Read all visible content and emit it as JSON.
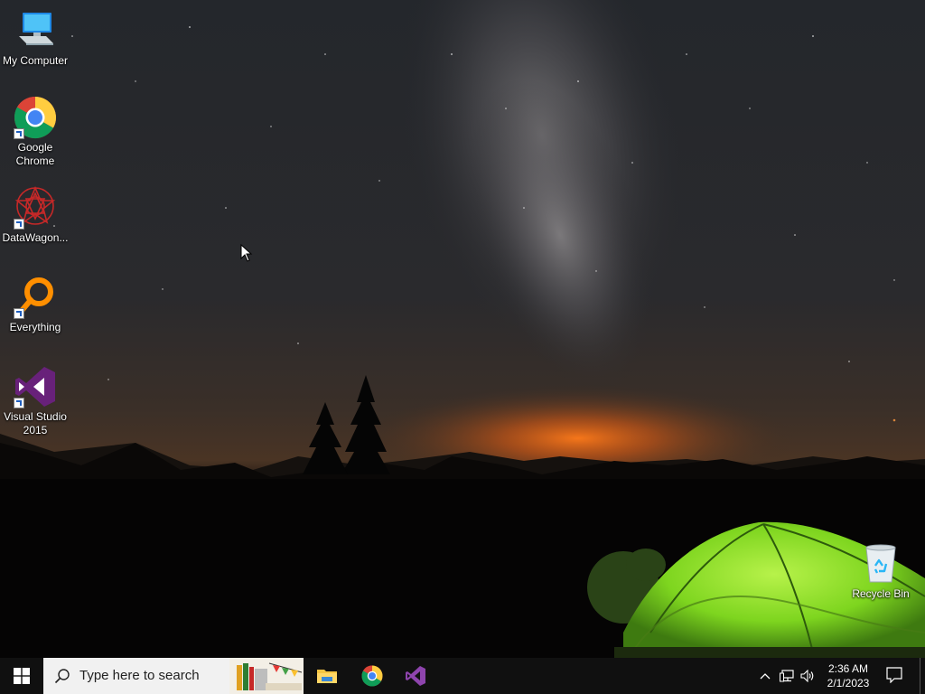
{
  "desktop": {
    "icons": [
      {
        "label": "My Computer",
        "icon": "computer-icon"
      },
      {
        "label": "Google Chrome",
        "icon": "chrome-icon"
      },
      {
        "label": "DataWagon...",
        "icon": "datawagon-icon"
      },
      {
        "label": "Everything",
        "icon": "everything-search-icon"
      },
      {
        "label": "Visual Studio 2015",
        "icon": "visual-studio-icon"
      },
      {
        "label": "Recycle Bin",
        "icon": "recycle-bin-icon"
      }
    ]
  },
  "taskbar": {
    "search_placeholder": "Type here to search",
    "pinned_apps": [
      "File Explorer",
      "Google Chrome",
      "Visual Studio 2015"
    ],
    "clock": {
      "time": "2:36 AM",
      "date": "2/1/2023"
    }
  },
  "colors": {
    "taskbar_bg": "#101010",
    "search_bg": "#f1f1f1",
    "windows_blue": "#ffffff",
    "tent_green": "#8ee22a"
  }
}
